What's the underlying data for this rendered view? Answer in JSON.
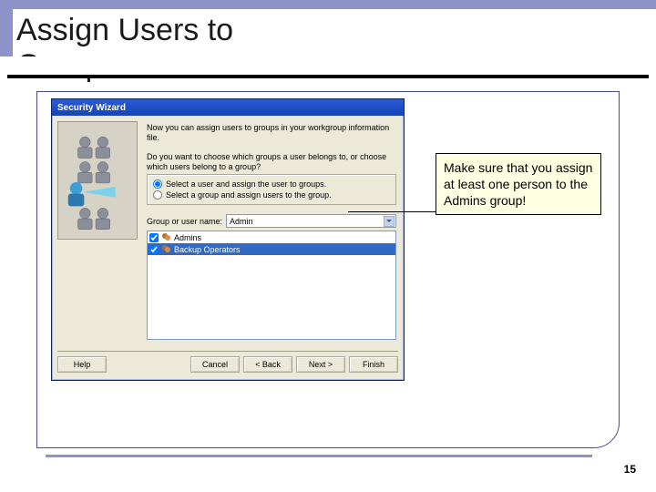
{
  "slide": {
    "title": "Assign Users to Groups",
    "page_number": "15"
  },
  "dialog": {
    "window_title": "Security Wizard",
    "intro": "Now you can assign users to groups in your workgroup information file.",
    "question": "Do you want to choose which groups a user belongs to, or choose which users belong to a group?",
    "radio_user": "Select a user and assign the user to groups.",
    "radio_group": "Select a group and assign users to the group.",
    "combo_label": "Group or user name:",
    "combo_value": "Admin",
    "list": {
      "items": [
        {
          "label": "Admins",
          "checked": true,
          "selected": false
        },
        {
          "label": "Backup Operators",
          "checked": true,
          "selected": true
        }
      ]
    },
    "buttons": {
      "help": "Help",
      "cancel": "Cancel",
      "back": "< Back",
      "next": "Next >",
      "finish": "Finish"
    }
  },
  "callout": {
    "text": "Make sure that you assign at least one person to the Admins group!"
  }
}
